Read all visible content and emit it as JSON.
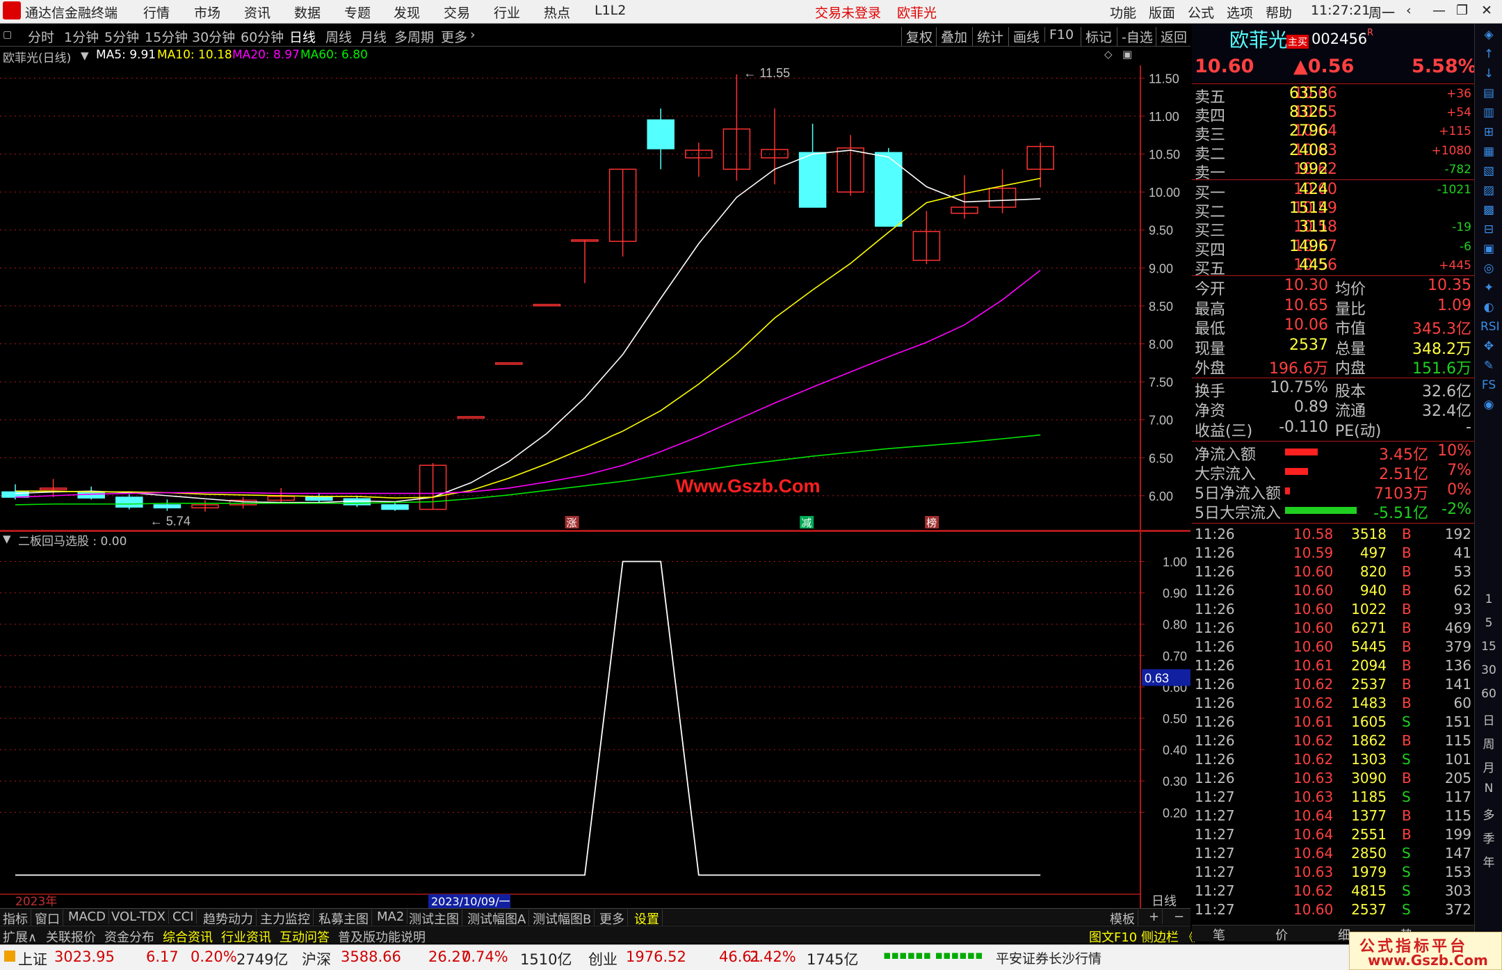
{
  "app": {
    "title": "通达信金融终端",
    "login_status": "交易未登录",
    "stock_name": "欧菲光",
    "time": "11:27:21",
    "weekday": "周一"
  },
  "menu": [
    "行情",
    "市场",
    "资讯",
    "数据",
    "专题",
    "发现",
    "交易",
    "行业",
    "热点",
    "L1L2"
  ],
  "menu_right": [
    "功能",
    "版面",
    "公式",
    "选项",
    "帮助"
  ],
  "periods": [
    "分时",
    "1分钟",
    "5分钟",
    "15分钟",
    "30分钟",
    "60分钟",
    "日线",
    "周线",
    "月线",
    "多周期",
    "更多"
  ],
  "active_period": "日线",
  "tools": [
    "复权",
    "叠加",
    "统计",
    "画线",
    "F10",
    "标记",
    "-自选",
    "返回"
  ],
  "chart_header": {
    "title": "欧菲光(日线)",
    "ma5": "MA5: 9.91",
    "ma10": "MA10: 10.18",
    "ma20": "MA20: 8.97",
    "ma60": "MA60: 6.80"
  },
  "colors": {
    "up": "#ff3232",
    "down": "#54ffff",
    "ma5": "#ffffff",
    "ma10": "#ffff00",
    "ma20": "#ff00ff",
    "ma60": "#00e600",
    "axis": "#b01818"
  },
  "chart_data": {
    "type": "candlestick",
    "y_ticks": [
      "11.50",
      "11.00",
      "10.50",
      "10.00",
      "9.50",
      "9.00",
      "8.50",
      "8.00",
      "7.50",
      "7.00",
      "6.50",
      "6.00"
    ],
    "ylim": [
      5.55,
      11.65
    ],
    "high_label": "11.55",
    "low_label": "5.74",
    "candles": [
      {
        "o": 6.05,
        "h": 6.15,
        "l": 5.95,
        "c": 5.98
      },
      {
        "o": 6.08,
        "h": 6.22,
        "l": 5.98,
        "c": 6.1
      },
      {
        "o": 6.05,
        "h": 6.12,
        "l": 5.95,
        "c": 5.97
      },
      {
        "o": 5.98,
        "h": 6.02,
        "l": 5.82,
        "c": 5.85
      },
      {
        "o": 5.88,
        "h": 5.95,
        "l": 5.8,
        "c": 5.84
      },
      {
        "o": 5.84,
        "h": 5.94,
        "l": 5.79,
        "c": 5.88
      },
      {
        "o": 5.88,
        "h": 5.98,
        "l": 5.83,
        "c": 5.94
      },
      {
        "o": 5.94,
        "h": 6.1,
        "l": 5.9,
        "c": 5.99
      },
      {
        "o": 5.98,
        "h": 6.04,
        "l": 5.9,
        "c": 5.94
      },
      {
        "o": 5.96,
        "h": 6.0,
        "l": 5.85,
        "c": 5.88
      },
      {
        "o": 5.88,
        "h": 5.92,
        "l": 5.8,
        "c": 5.82
      },
      {
        "o": 5.82,
        "h": 6.43,
        "l": 5.82,
        "c": 6.4
      },
      {
        "o": 7.04,
        "h": 7.04,
        "l": 7.04,
        "c": 7.04
      },
      {
        "o": 7.75,
        "h": 7.75,
        "l": 7.75,
        "c": 7.75
      },
      {
        "o": 8.52,
        "h": 8.52,
        "l": 8.52,
        "c": 8.52
      },
      {
        "o": 9.37,
        "h": 9.37,
        "l": 8.8,
        "c": 9.37
      },
      {
        "o": 9.35,
        "h": 10.3,
        "l": 9.15,
        "c": 10.3
      },
      {
        "o": 10.95,
        "h": 11.1,
        "l": 10.3,
        "c": 10.57
      },
      {
        "o": 10.45,
        "h": 10.65,
        "l": 10.2,
        "c": 10.55
      },
      {
        "o": 10.3,
        "h": 11.55,
        "l": 10.15,
        "c": 10.83
      },
      {
        "o": 10.45,
        "h": 11.1,
        "l": 10.1,
        "c": 10.56
      },
      {
        "o": 10.52,
        "h": 10.9,
        "l": 9.8,
        "c": 9.8
      },
      {
        "o": 10.0,
        "h": 10.75,
        "l": 9.95,
        "c": 10.58
      },
      {
        "o": 10.52,
        "h": 10.58,
        "l": 9.55,
        "c": 9.55
      },
      {
        "o": 9.1,
        "h": 9.75,
        "l": 9.05,
        "c": 9.48
      },
      {
        "o": 9.72,
        "h": 10.22,
        "l": 9.65,
        "c": 9.8
      },
      {
        "o": 9.8,
        "h": 10.3,
        "l": 9.72,
        "c": 10.05
      },
      {
        "o": 10.3,
        "h": 10.65,
        "l": 10.06,
        "c": 10.6
      }
    ],
    "ma5": [
      6.03,
      6.05,
      6.06,
      6.04,
      6.0,
      5.96,
      5.92,
      5.91,
      5.91,
      5.93,
      5.92,
      5.98,
      6.17,
      6.45,
      6.82,
      7.29,
      7.86,
      8.6,
      9.32,
      9.93,
      10.3,
      10.5,
      10.55,
      10.46,
      10.07,
      9.87,
      9.89,
      9.91
    ],
    "ma10": [
      6.06,
      6.06,
      6.05,
      6.05,
      6.04,
      6.02,
      6.01,
      6.0,
      5.99,
      5.99,
      5.97,
      5.98,
      6.07,
      6.23,
      6.42,
      6.63,
      6.85,
      7.12,
      7.47,
      7.87,
      8.34,
      8.71,
      9.06,
      9.47,
      9.86,
      9.98,
      10.08,
      10.18
    ],
    "ma20": [
      5.98,
      6.0,
      6.02,
      6.03,
      6.04,
      6.04,
      6.04,
      6.03,
      6.03,
      6.03,
      6.03,
      6.03,
      6.05,
      6.1,
      6.18,
      6.27,
      6.4,
      6.58,
      6.78,
      7.0,
      7.22,
      7.43,
      7.63,
      7.83,
      8.02,
      8.25,
      8.58,
      8.97
    ],
    "ma60": [
      5.88,
      5.89,
      5.89,
      5.89,
      5.9,
      5.9,
      5.9,
      5.9,
      5.9,
      5.9,
      5.91,
      5.92,
      5.96,
      6.01,
      6.07,
      6.13,
      6.19,
      6.26,
      6.33,
      6.4,
      6.46,
      6.52,
      6.57,
      6.62,
      6.66,
      6.7,
      6.75,
      6.8
    ],
    "markers": [
      "涨",
      "减",
      "榜"
    ],
    "indicator": {
      "title": "二板回马选股 : 0.00",
      "y_ticks": [
        "1.00",
        "0.90",
        "0.80",
        "0.70",
        "0.60",
        "0.50",
        "0.40",
        "0.30",
        "0.20"
      ],
      "ylim": [
        -0.03,
        1.03
      ],
      "current_label": "0.63",
      "values": [
        0,
        0,
        0,
        0,
        0,
        0,
        0,
        0,
        0,
        0,
        0,
        0,
        0,
        0,
        0,
        0,
        1,
        1,
        0,
        0,
        0,
        0,
        0,
        0,
        0,
        0,
        0,
        0
      ]
    },
    "x_labels": [
      "2023年",
      "2023/10/09/一"
    ],
    "period_label": "日线"
  },
  "quote": {
    "name": "欧菲光",
    "badge": "主买",
    "code": "002456",
    "flag": "R",
    "price": "10.60",
    "change": "▲0.56",
    "pct": "5.58%",
    "asks": [
      {
        "label": "卖五",
        "price": "10.66",
        "vol": "6353",
        "chg": "+36"
      },
      {
        "label": "卖四",
        "price": "10.65",
        "vol": "8325",
        "chg": "+54"
      },
      {
        "label": "卖三",
        "price": "10.64",
        "vol": "2796",
        "chg": "+115"
      },
      {
        "label": "卖二",
        "price": "10.63",
        "vol": "2408",
        "chg": "+1080"
      },
      {
        "label": "卖一",
        "price": "10.62",
        "vol": "992",
        "chg": "-782"
      }
    ],
    "bids": [
      {
        "label": "买一",
        "price": "10.60",
        "vol": "424",
        "chg": "-1021"
      },
      {
        "label": "买二",
        "price": "10.59",
        "vol": "1514",
        "chg": ""
      },
      {
        "label": "买三",
        "price": "10.58",
        "vol": "311",
        "chg": "-19"
      },
      {
        "label": "买四",
        "price": "10.57",
        "vol": "1496",
        "chg": "-6"
      },
      {
        "label": "买五",
        "price": "10.56",
        "vol": "445",
        "chg": "+445"
      }
    ],
    "stats1": [
      {
        "l1": "今开",
        "v1": "10.30",
        "l2": "均价",
        "v2": "10.35"
      },
      {
        "l1": "最高",
        "v1": "10.65",
        "l2": "量比",
        "v2": "1.09"
      },
      {
        "l1": "最低",
        "v1": "10.06",
        "l2": "市值",
        "v2": "345.3亿"
      },
      {
        "l1": "现量",
        "v1": "2537",
        "l2": "总量",
        "v2": "348.2万"
      },
      {
        "l1": "外盘",
        "v1": "196.6万",
        "l2": "内盘",
        "v2": "151.6万"
      }
    ],
    "stats2": [
      {
        "l1": "换手",
        "v1": "10.75%",
        "l2": "股本",
        "v2": "32.6亿"
      },
      {
        "l1": "净资",
        "v1": "0.89",
        "l2": "流通",
        "v2": "32.4亿"
      },
      {
        "l1": "收益(三)",
        "v1": "-0.110",
        "l2": "PE(动)",
        "v2": "-"
      }
    ],
    "flows": [
      {
        "label": "净流入额",
        "value": "3.45亿",
        "pct": "10%",
        "bar": 0.1,
        "pos": true
      },
      {
        "label": "大宗流入",
        "value": "2.51亿",
        "pct": "7%",
        "bar": 0.07,
        "pos": true
      },
      {
        "label": "5日净流入额",
        "value": "7103万",
        "pct": "0%",
        "bar": 0.015,
        "pos": true
      },
      {
        "label": "5日大宗流入",
        "value": "-5.51亿",
        "pct": "-2%",
        "bar": 0.22,
        "pos": false
      }
    ],
    "ticks": [
      {
        "t": "11:26",
        "p": "10.58",
        "v": "3518",
        "s": "B",
        "n": "192"
      },
      {
        "t": "11:26",
        "p": "10.59",
        "v": "497",
        "s": "B",
        "n": "41"
      },
      {
        "t": "11:26",
        "p": "10.60",
        "v": "820",
        "s": "B",
        "n": "53"
      },
      {
        "t": "11:26",
        "p": "10.60",
        "v": "940",
        "s": "B",
        "n": "62"
      },
      {
        "t": "11:26",
        "p": "10.60",
        "v": "1022",
        "s": "B",
        "n": "93"
      },
      {
        "t": "11:26",
        "p": "10.60",
        "v": "6271",
        "s": "B",
        "n": "469"
      },
      {
        "t": "11:26",
        "p": "10.60",
        "v": "5445",
        "s": "B",
        "n": "379"
      },
      {
        "t": "11:26",
        "p": "10.61",
        "v": "2094",
        "s": "B",
        "n": "136"
      },
      {
        "t": "11:26",
        "p": "10.62",
        "v": "2537",
        "s": "B",
        "n": "141"
      },
      {
        "t": "11:26",
        "p": "10.62",
        "v": "1483",
        "s": "B",
        "n": "60"
      },
      {
        "t": "11:26",
        "p": "10.61",
        "v": "1605",
        "s": "S",
        "n": "151"
      },
      {
        "t": "11:26",
        "p": "10.62",
        "v": "1862",
        "s": "B",
        "n": "115"
      },
      {
        "t": "11:26",
        "p": "10.62",
        "v": "1303",
        "s": "S",
        "n": "101"
      },
      {
        "t": "11:26",
        "p": "10.63",
        "v": "3090",
        "s": "B",
        "n": "205"
      },
      {
        "t": "11:27",
        "p": "10.63",
        "v": "1185",
        "s": "S",
        "n": "117"
      },
      {
        "t": "11:27",
        "p": "10.64",
        "v": "1377",
        "s": "B",
        "n": "115"
      },
      {
        "t": "11:27",
        "p": "10.64",
        "v": "2551",
        "s": "B",
        "n": "199"
      },
      {
        "t": "11:27",
        "p": "10.64",
        "v": "2850",
        "s": "S",
        "n": "147"
      },
      {
        "t": "11:27",
        "p": "10.63",
        "v": "1979",
        "s": "S",
        "n": "153"
      },
      {
        "t": "11:27",
        "p": "10.62",
        "v": "4815",
        "s": "S",
        "n": "303"
      },
      {
        "t": "11:27",
        "p": "10.60",
        "v": "2537",
        "s": "S",
        "n": "372"
      }
    ],
    "bottom_tabs": [
      "笔",
      "价",
      "细",
      "势"
    ]
  },
  "side_icons": [
    "1",
    "5",
    "15",
    "30",
    "60",
    "日",
    "周",
    "月",
    "N",
    "多",
    "季",
    "年"
  ],
  "bottom_tabs1": [
    "指标",
    "窗口",
    "MACD",
    "VOL-TDX",
    "CCI",
    "趋势动力",
    "主力监控",
    "私募主图",
    "MA2",
    "测试主图",
    "测试幅图A",
    "测试幅图B",
    "更多",
    "设置"
  ],
  "template_label": "模板",
  "bottom_tabs2": [
    "扩展∧",
    "关联报价",
    "资金分布",
    "综合资讯",
    "行业资讯",
    "互动问答",
    "普及版功能说明"
  ],
  "f10_label": "图文F10 侧边栏 《",
  "status": [
    {
      "name": "上证",
      "price": "3023.95",
      "chg": "6.17",
      "pct": "0.20%",
      "amt": "2749亿"
    },
    {
      "name": "沪深",
      "price": "3588.66",
      "chg": "26.27",
      "pct": "0.74%",
      "amt": "1510亿"
    },
    {
      "name": "创业",
      "price": "1976.52",
      "chg": "46.61",
      "pct": "2.42%",
      "amt": "1745亿"
    }
  ],
  "broker": "平安证券长沙行情",
  "watermark": {
    "center": "Www.Gszb.Com",
    "corner_top": "公式指标平台",
    "corner_bottom": "www.Gszb.Com"
  }
}
